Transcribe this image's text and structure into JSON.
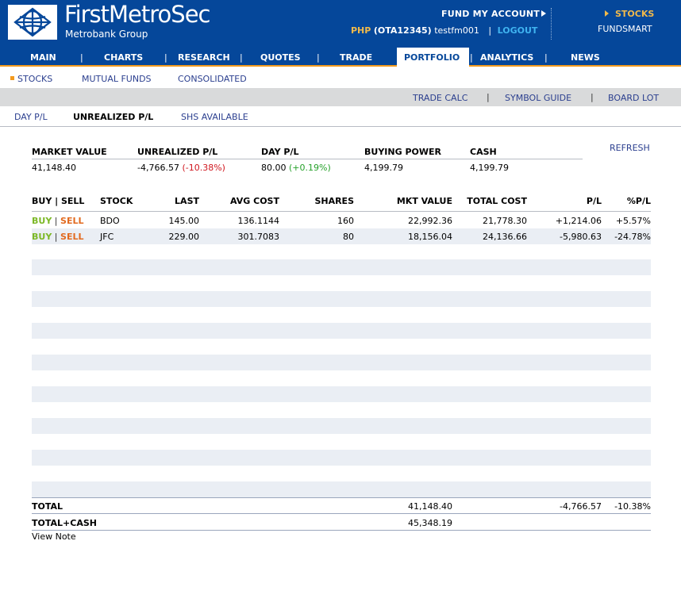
{
  "header": {
    "brand": "FirstMetroSec",
    "brand_sub": "Metrobank Group",
    "fund_my_account": "FUND MY ACCOUNT",
    "currency": "PHP",
    "account": "(OTA12345)",
    "username": "testfm001",
    "separator": "|",
    "logout": "LOGOUT",
    "stocks": "STOCKS",
    "fundsmart": "FUNDSMART"
  },
  "nav": {
    "items": [
      "MAIN",
      "CHARTS",
      "RESEARCH",
      "QUOTES",
      "TRADE",
      "PORTFOLIO",
      "ANALYTICS",
      "NEWS"
    ],
    "separator": "|",
    "active": "PORTFOLIO"
  },
  "subnav": {
    "items": [
      "STOCKS",
      "MUTUAL FUNDS",
      "CONSOLIDATED"
    ]
  },
  "toolbar": {
    "items": [
      "TRADE CALC",
      "SYMBOL GUIDE",
      "BOARD LOT"
    ],
    "separator": "|"
  },
  "pl_tabs": {
    "items": [
      "DAY P/L",
      "UNREALIZED P/L",
      "SHS AVAILABLE"
    ],
    "active": "UNREALIZED P/L"
  },
  "summary": {
    "headers": [
      "MARKET VALUE",
      "UNREALIZED P/L",
      "DAY P/L",
      "BUYING POWER",
      "CASH"
    ],
    "market_value": "41,148.40",
    "unrealized_pl": "-4,766.57",
    "unrealized_pct": "(-10.38%)",
    "day_pl": "80.00",
    "day_pct": "(+0.19%)",
    "buying_power": "4,199.79",
    "cash": "4,199.79",
    "refresh": "REFRESH"
  },
  "table": {
    "headers": [
      "BUY | SELL",
      "STOCK",
      "LAST",
      "AVG COST",
      "SHARES",
      "MKT VALUE",
      "TOTAL COST",
      "P/L",
      "%P/L"
    ],
    "buy_label": "BUY",
    "sell_label": "SELL",
    "bs_separator": "|",
    "rows": [
      {
        "stock": "BDO",
        "last": "145.00",
        "avg_cost": "136.1144",
        "shares": "160",
        "mkt_value": "22,992.36",
        "total_cost": "21,778.30",
        "pl": "+1,214.06",
        "pct": "+5.57%"
      },
      {
        "stock": "JFC",
        "last": "229.00",
        "avg_cost": "301.7083",
        "shares": "80",
        "mkt_value": "18,156.04",
        "total_cost": "24,136.66",
        "pl": "-5,980.63",
        "pct": "-24.78%"
      }
    ]
  },
  "totals": {
    "total_label": "TOTAL",
    "total_mkt_value": "41,148.40",
    "total_pl": "-4,766.57",
    "total_pct": "-10.38%",
    "total_cash_label": "TOTAL+CASH",
    "total_cash_value": "45,348.19",
    "view_note": "View Note"
  },
  "colors": {
    "header_blue": "#05479a",
    "accent_orange": "#f39a1e",
    "gold": "#f0b94b",
    "link_blue": "#2b3f8f",
    "positive": "#26a12a",
    "negative": "#d0161e",
    "buy": "#7cb827",
    "sell": "#e26a1f",
    "row_alt": "#eaeef4"
  },
  "icons": {
    "logo": "globe-logo-icon",
    "fund_arrow": "triangle-right-icon",
    "stocks_arrow": "triangle-right-icon",
    "subnav_bullet": "square-bullet-icon"
  }
}
